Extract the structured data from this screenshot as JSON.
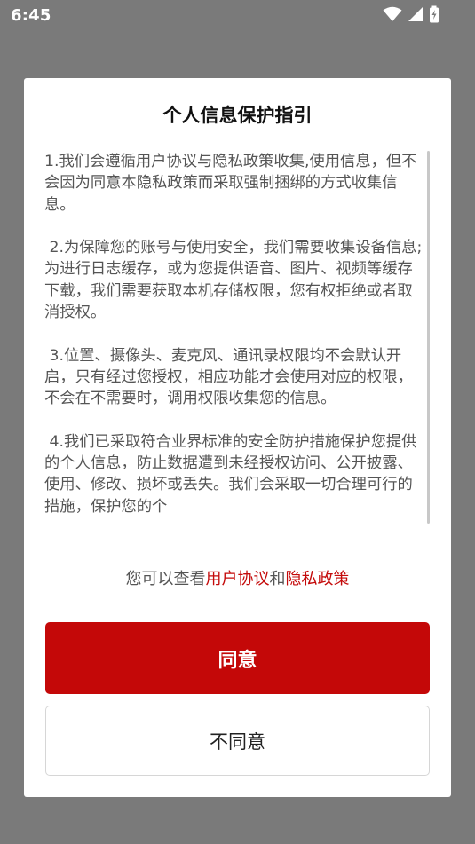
{
  "status_bar": {
    "time": "6:45",
    "icons": [
      "wifi-icon",
      "signal-icon",
      "battery-charging-icon"
    ],
    "color": "#ffffff"
  },
  "dialog": {
    "title": "个人信息保护指引",
    "paragraphs": [
      "1.我们会遵循用户协议与隐私政策收集,使用信息，但不会因为同意本隐私政策而采取强制捆绑的方式收集信息。",
      " 2.为保障您的账号与使用安全，我们需要收集设备信息;为进行日志缓存，或为您提供语音、图片、视频等缓存下载，我们需要获取本机存储权限，您有权拒绝或者取消授权。",
      " 3.位置、摄像头、麦克风、通讯录权限均不会默认开启，只有经过您授权，相应功能才会使用对应的权限，不会在不需要时，调用权限收集您的信息。",
      " 4.我们已采取符合业界标准的安全防护措施保护您提供的个人信息，防止数据遭到未经授权访问、公开披露、使用、修改、损坏或丢失。我们会采取一切合理可行的措施，保护您的个"
    ],
    "links_line": {
      "prefix": "您可以查看",
      "user_agreement": "用户协议",
      "connector": "和",
      "privacy_policy": "隐私政策"
    },
    "agree_label": "同意",
    "disagree_label": "不同意"
  },
  "colors": {
    "overlay": "#7a7a7a",
    "accent": "#c40808",
    "link": "#c40a0a"
  }
}
